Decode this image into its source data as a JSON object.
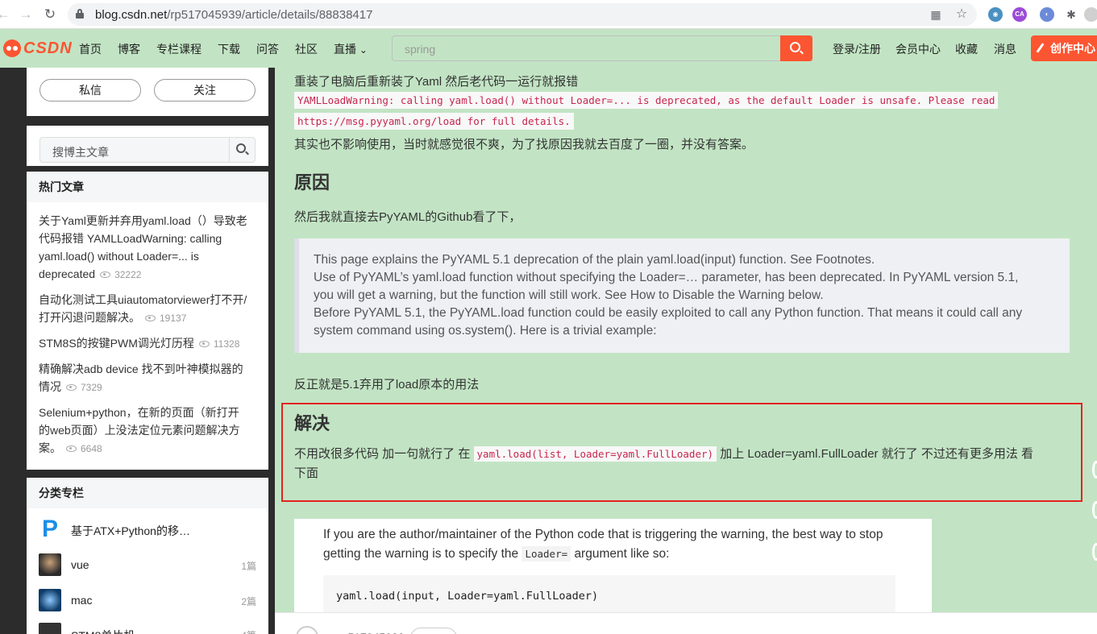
{
  "browser": {
    "back": "←",
    "forward": "→",
    "reload": "↻",
    "url_host": "blog.csdn.net",
    "url_path": "/rp517045939/article/details/88838417"
  },
  "header": {
    "logo": "CSDN",
    "nav": [
      "首页",
      "博客",
      "专栏课程",
      "下载",
      "问答",
      "社区",
      "直播"
    ],
    "live_chevron": "⌄",
    "search_placeholder": "spring",
    "links": [
      "登录/注册",
      "会员中心",
      "收藏",
      "消息"
    ],
    "create": "创作中心"
  },
  "sidebar": {
    "message_btn": "私信",
    "follow_btn": "关注",
    "search_placeholder": "搜博主文章",
    "hot_title": "热门文章",
    "hot": [
      {
        "title": "关于Yaml更新并弃用yaml.load（）导致老代码报错 YAMLLoadWarning: calling yaml.load() without Loader=... is deprecated",
        "views": "32222"
      },
      {
        "title": "自动化测试工具uiautomatorviewer打不开/打开闪退问题解决。",
        "views": "19137"
      },
      {
        "title": "STM8S的按键PWM调光灯历程",
        "views": "11328"
      },
      {
        "title": "精确解决adb device 找不到叶神模拟器的情况",
        "views": "7329"
      },
      {
        "title": "Selenium+python，在新的页面（新打开的web页面）上没法定位元素问题解决方案。",
        "views": "6648"
      }
    ],
    "col_title": "分类专栏",
    "columns": [
      {
        "name": "基于ATX+Python的移…",
        "count": ""
      },
      {
        "name": "vue",
        "count": "1篇"
      },
      {
        "name": "mac",
        "count": "2篇"
      },
      {
        "name": "STM8单片机",
        "count": "4篇"
      }
    ]
  },
  "article": {
    "p1": "重装了电脑后重新装了Yaml 然后老代码一运行就报错",
    "warn1": "YAMLLoadWarning: calling yaml.load() without Loader=... is deprecated, as the default Loader is unsafe. Please read",
    "warn2": "https://msg.pyyaml.org/load for full details.",
    "p2": "其实也不影响使用，当时就感觉很不爽，为了找原因我就去百度了一圈，并没有答案。",
    "h_reason": "原因",
    "p3": "然后我就直接去PyYAML的Github看了下，",
    "quote": [
      "This page explains the PyYAML 5.1 deprecation of the plain yaml.load(input) function. See Footnotes.",
      "Use of PyYAML’s yaml.load function without specifying the Loader=… parameter, has been deprecated. In PyYAML version 5.1,",
      "you will get a warning, but the function will still work. See How to Disable the Warning below.",
      "Before PyYAML 5.1, the PyYAML.load function could be easily exploited to call any Python function. That means it could call any",
      "system command using os.system(). Here is a trivial example:"
    ],
    "p4": "反正就是5.1弃用了load原本的用法",
    "h_solution": "解决",
    "sol_before": "不用改很多代码 加一句就行了 在",
    "sol_code": "yaml.load(list, Loader=yaml.FullLoader)",
    "sol_after": "加上 Loader=yaml.FullLoader 就行了 不过还有更多用法 看",
    "sol_line2": "下面",
    "shot_text_a": "If you are the author/maintainer of the Python code that is triggering the warning, the best way to stop getting the warning is to specify the",
    "shot_inline": "Loader=",
    "shot_text_b": "argument like so:",
    "shot_code": "yaml.load(input, Loader=yaml.FullLoader)",
    "bottom_user": "rp517045939"
  }
}
